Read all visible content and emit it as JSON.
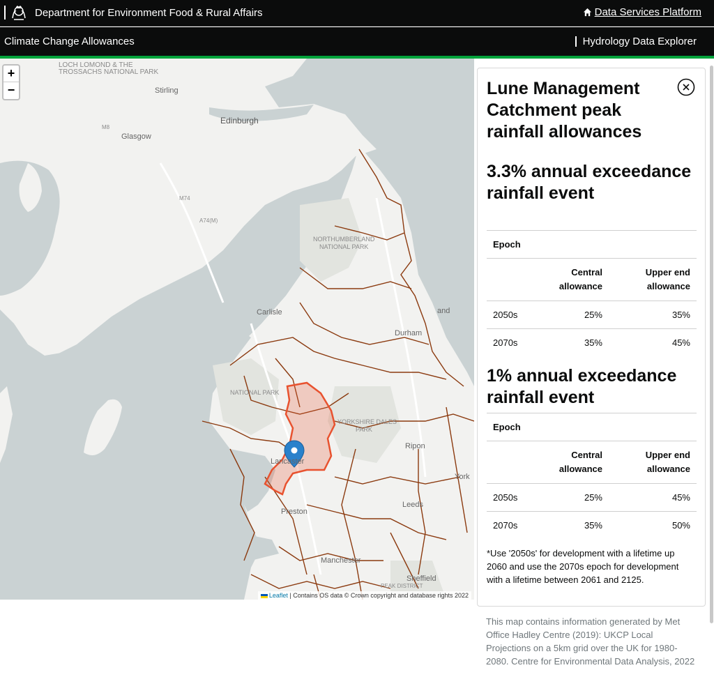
{
  "header": {
    "org_name": "Department for Environment Food & Rural Affairs",
    "platform_link": "Data Services Platform"
  },
  "subheader": {
    "title": "Climate Change Allowances",
    "nav_link": "Hydrology Data Explorer"
  },
  "map": {
    "zoom_in": "+",
    "zoom_out": "−",
    "attribution_link": "Leaflet",
    "attribution_text": "| Contains OS data © Crown copyright and database rights 2022",
    "labels": {
      "loch": "LOCH LOMOND & THE",
      "trossachs": "TROSSACHS NATIONAL PARK",
      "stirling": "Stirling",
      "edinburgh": "Edinburgh",
      "glasgow": "Glasgow",
      "m8": "M8",
      "m74": "M74",
      "a74m": "A74(M)",
      "northumberland": "NORTHUMBERLAND",
      "national_park": "NATIONAL PARK",
      "carlisle": "Carlisle",
      "sunderland": "and",
      "durham": "Durham",
      "lake_district": "NATIONAL PARK",
      "yorkshire_dales": "YORKSHIRE DALES",
      "yd_park": "PARK",
      "ripon": "Ripon",
      "lancaster": "Lancaster",
      "york": "York",
      "leeds": "Leeds",
      "preston": "Preston",
      "manchester": "Manchester",
      "sheffield": "Sheffield",
      "peak": "PEAK DISTRICT"
    },
    "colors": {
      "water": "#cad2d3",
      "land": "#f2f2f0",
      "catchment": "#8b3a0f",
      "selected": "#e8522f"
    }
  },
  "panel": {
    "title": "Lune Management Catchment peak rainfall allowances",
    "close_icon": "close-circle-icon",
    "sections": [
      {
        "heading": "3.3% annual exceedance rainfall event",
        "epoch_label": "Epoch",
        "col_central": "Central allowance",
        "col_upper": "Upper end allowance",
        "rows": [
          {
            "epoch": "2050s",
            "central": "25%",
            "upper": "35%"
          },
          {
            "epoch": "2070s",
            "central": "35%",
            "upper": "45%"
          }
        ]
      },
      {
        "heading": "1% annual exceedance rainfall event",
        "epoch_label": "Epoch",
        "col_central": "Central allowance",
        "col_upper": "Upper end allowance",
        "rows": [
          {
            "epoch": "2050s",
            "central": "25%",
            "upper": "45%"
          },
          {
            "epoch": "2070s",
            "central": "35%",
            "upper": "50%"
          }
        ]
      }
    ],
    "footnote": "*Use '2050s' for development with a lifetime up 2060 and use the 2070s epoch for development with a lifetime between 2061 and 2125."
  },
  "source_note": "This map contains information generated by Met Office Hadley Centre (2019): UKCP Local Projections on a 5km grid over the UK for 1980-2080. Centre for Environmental Data Analysis, 2022"
}
